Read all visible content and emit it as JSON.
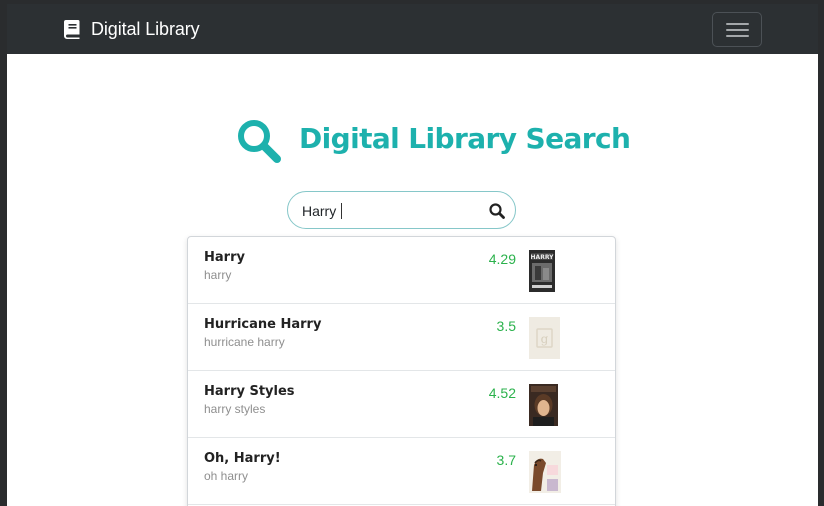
{
  "app": {
    "brand": "Digital Library"
  },
  "hero": {
    "title": "Digital Library Search"
  },
  "search": {
    "value": "Harry",
    "placeholder": ""
  },
  "results": [
    {
      "title": "Harry",
      "subtitle": "harry",
      "rating": "4.29",
      "cover": "dark-book-cover"
    },
    {
      "title": "Hurricane Harry",
      "subtitle": "hurricane harry",
      "rating": "3.5",
      "cover": "placeholder-cover"
    },
    {
      "title": "Harry Styles",
      "subtitle": "harry styles",
      "rating": "4.52",
      "cover": "portrait-cover"
    },
    {
      "title": "Oh, Harry!",
      "subtitle": "oh harry",
      "rating": "3.7",
      "cover": "horse-cover"
    }
  ],
  "colors": {
    "accent": "#1db1ad",
    "navbar": "#2c3033",
    "rating": "#2bb24c"
  },
  "icons": {
    "brand": "book-icon",
    "hero": "search-icon",
    "search_button": "search-icon",
    "menu": "hamburger-icon"
  }
}
